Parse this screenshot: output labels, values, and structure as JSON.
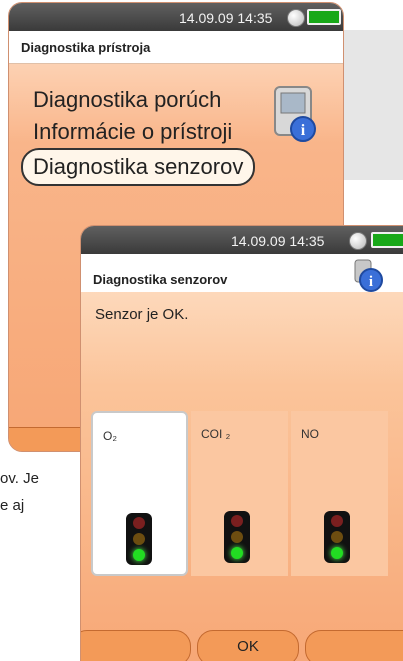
{
  "back_screen": {
    "status": {
      "time": "14.09.09  14:35"
    },
    "title": "Diagnostika prístroja",
    "menu": [
      {
        "label": "Diagnostika porúch"
      },
      {
        "label": "Informácie o prístroji"
      },
      {
        "label": "Diagnostika senzorov",
        "selected": true
      }
    ],
    "icons": {
      "device": "device-info-icon",
      "battery": "battery-icon",
      "status": "status-circle-icon"
    }
  },
  "front_screen": {
    "status": {
      "time": "14.09.09  14:35"
    },
    "title": "Diagnostika senzorov",
    "message": "Senzor je OK.",
    "sensors": [
      {
        "name": "O₂",
        "status": "ok"
      },
      {
        "name": "COI ₂",
        "status": "ok"
      },
      {
        "name": "NO",
        "status": "ok"
      }
    ],
    "softkeys": {
      "center": "OK"
    },
    "icons": {
      "info": "info-icon",
      "traffic_light": "traffic-light-icon"
    }
  },
  "side_text": {
    "line1": "ov. Je",
    "line2": "e aj"
  },
  "colors": {
    "screen_orange": "#f7a877",
    "softkey": "#f39a58",
    "status_green": "#18a818"
  }
}
